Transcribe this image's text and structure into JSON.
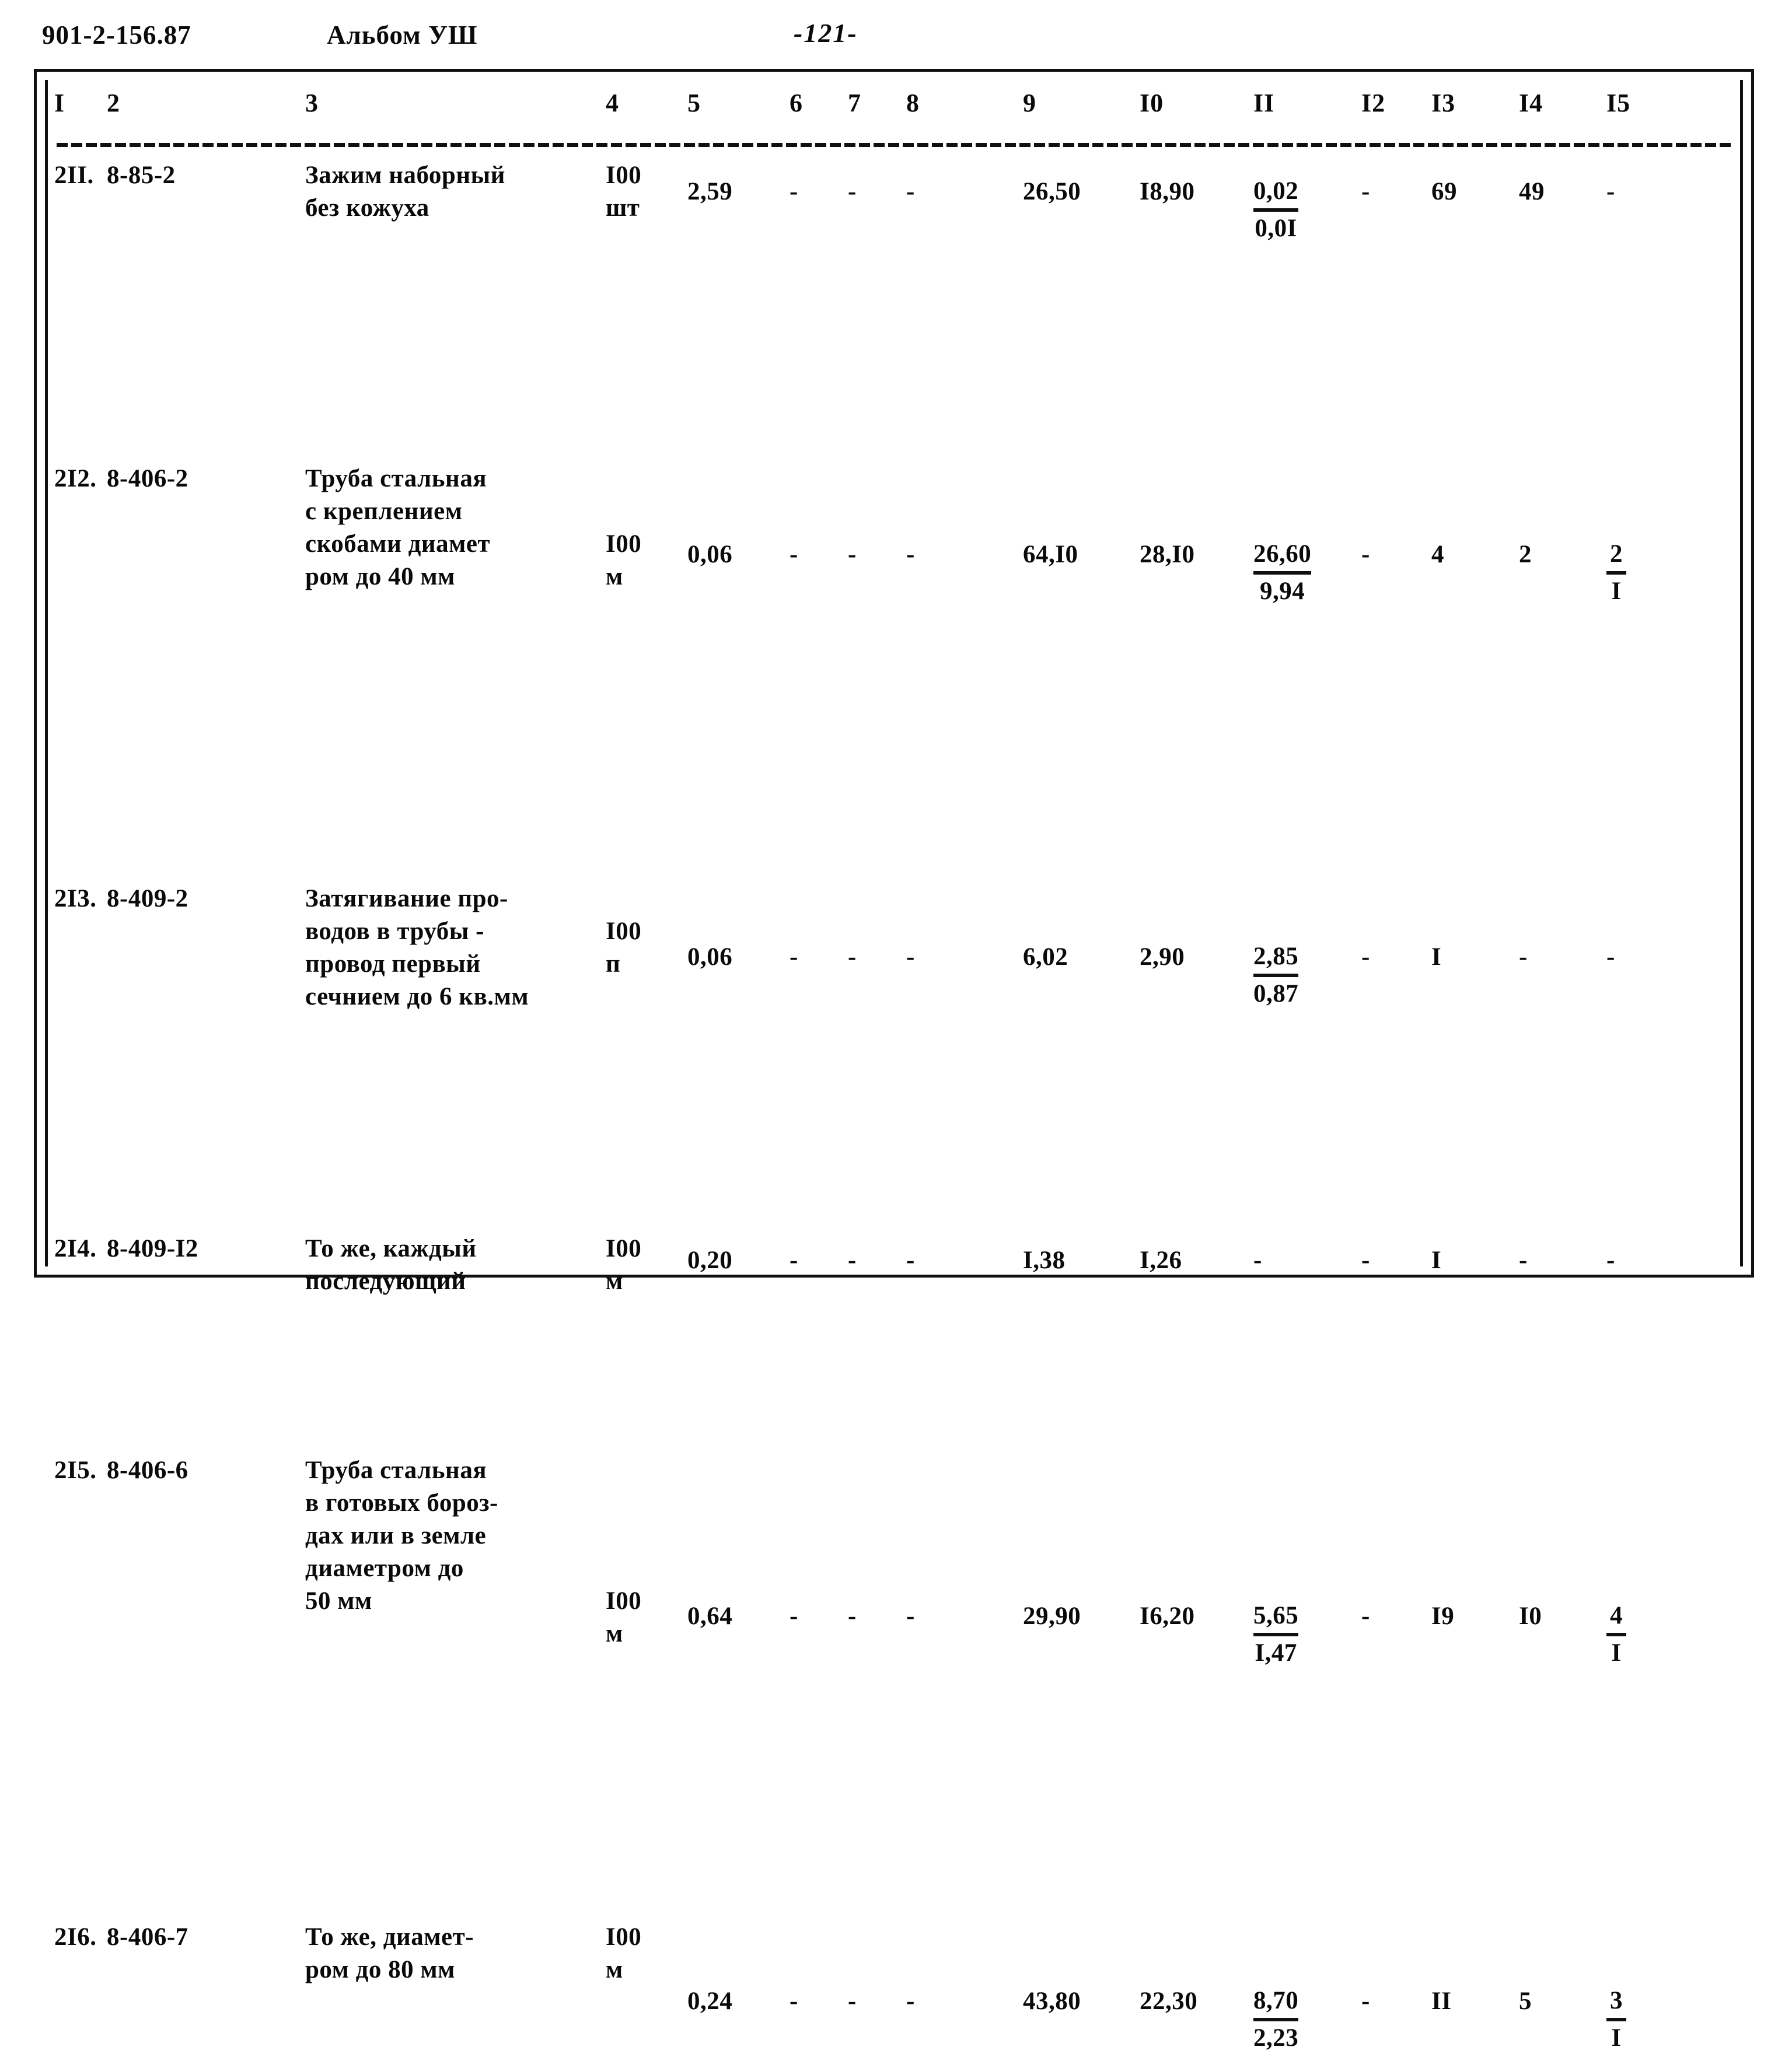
{
  "header": {
    "doc_code": "901-2-156.87",
    "album": "Альбом УШ",
    "page_number": "-121-"
  },
  "table": {
    "column_headers": [
      "I",
      "2",
      "3",
      "4",
      "5",
      "6",
      "7",
      "8",
      "9",
      "I0",
      "II",
      "I2",
      "I3",
      "I4",
      "I5"
    ],
    "rows": [
      {
        "c1": "2II.",
        "c2": "8-85-2",
        "c3": "Зажим наборный\nбез кожуха",
        "c4": "I00\nшт",
        "c5": "2,59",
        "c6": "-",
        "c7": "-",
        "c8": "-",
        "c9": "26,50",
        "c10": "I8,90",
        "c11_top": "0,02",
        "c11_bot": "0,0I",
        "c12": "-",
        "c13": "69",
        "c14": "49",
        "c15_top": "-",
        "c15_bot": ""
      },
      {
        "c1": "2I2.",
        "c2": "8-406-2",
        "c3": "Труба стальная\nс креплением\nскобами диамет\nром до 40 мм",
        "c4": "I00\nм",
        "c5": "0,06",
        "c6": "-",
        "c7": "-",
        "c8": "-",
        "c9": "64,I0",
        "c10": "28,I0",
        "c11_top": "26,60",
        "c11_bot": "9,94",
        "c12": "-",
        "c13": "4",
        "c14": "2",
        "c15_top": "2",
        "c15_bot": "I"
      },
      {
        "c1": "2I3.",
        "c2": "8-409-2",
        "c3": "Затягивание про-\nводов в трубы -\nпровод первый\nсечнием до 6 кв.мм",
        "c4": "I00\nп",
        "c5": "0,06",
        "c6": "-",
        "c7": "-",
        "c8": "-",
        "c9": "6,02",
        "c10": "2,90",
        "c11_top": "2,85",
        "c11_bot": "0,87",
        "c12": "-",
        "c13": "I",
        "c14": "-",
        "c15_top": "-",
        "c15_bot": ""
      },
      {
        "c1": "2I4.",
        "c2": "8-409-I2",
        "c3": "То же, каждый\nпоследующий",
        "c4": "I00\nм",
        "c5": "0,20",
        "c6": "-",
        "c7": "-",
        "c8": "-",
        "c9": "I,38",
        "c10": "I,26",
        "c11_top": "-",
        "c11_bot": "",
        "c12": "-",
        "c13": "I",
        "c14": "-",
        "c15_top": "-",
        "c15_bot": ""
      },
      {
        "c1": "2I5.",
        "c2": "8-406-6",
        "c3": "Труба стальная\nв готовых бороз-\nдах или в земле\nдиаметром до\n50 мм",
        "c4": "I00\nм",
        "c5": "0,64",
        "c6": "-",
        "c7": "-",
        "c8": "-",
        "c9": "29,90",
        "c10": "I6,20",
        "c11_top": "5,65",
        "c11_bot": "I,47",
        "c12": "-",
        "c13": "I9",
        "c14": "I0",
        "c15_top": "4",
        "c15_bot": "I"
      },
      {
        "c1": "2I6.",
        "c2": "8-406-7",
        "c3": "То же, диамет-\nром до 80 мм",
        "c4": "I00\nм",
        "c5": "0,24",
        "c6": "-",
        "c7": "-",
        "c8": "-",
        "c9": "43,80",
        "c10": "22,30",
        "c11_top": "8,70",
        "c11_bot": "2,23",
        "c12": "-",
        "c13": "II",
        "c14": "5",
        "c15_top": "3",
        "c15_bot": "I"
      }
    ]
  }
}
